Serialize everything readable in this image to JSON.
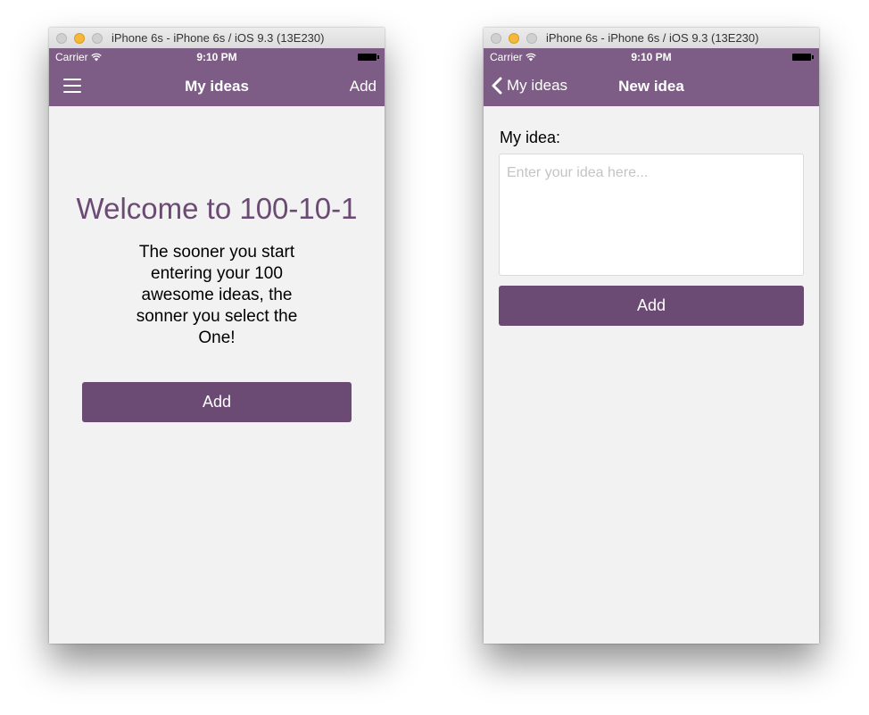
{
  "left_window": {
    "title": "iPhone 6s - iPhone 6s / iOS 9.3 (13E230)",
    "status": {
      "carrier": "Carrier",
      "time": "9:10 PM"
    },
    "nav": {
      "title": "My ideas",
      "right_label": "Add"
    },
    "welcome": {
      "heading": "Welcome to 100-10-1",
      "text": "The sooner you start entering your 100 awesome ideas, the sonner you select the One!",
      "button_label": "Add"
    }
  },
  "right_window": {
    "title": "iPhone 6s - iPhone 6s / iOS 9.3 (13E230)",
    "status": {
      "carrier": "Carrier",
      "time": "9:10 PM"
    },
    "nav": {
      "back_label": "My ideas",
      "title": "New idea"
    },
    "form": {
      "label": "My idea:",
      "placeholder": "Enter your idea here...",
      "button_label": "Add"
    }
  },
  "colors": {
    "nav": "#7d5d85",
    "accent": "#6b4a73",
    "background": "#f2f2f2"
  },
  "icons": [
    "hamburger-menu-icon",
    "chevron-left-icon",
    "wifi-icon",
    "battery-icon"
  ]
}
